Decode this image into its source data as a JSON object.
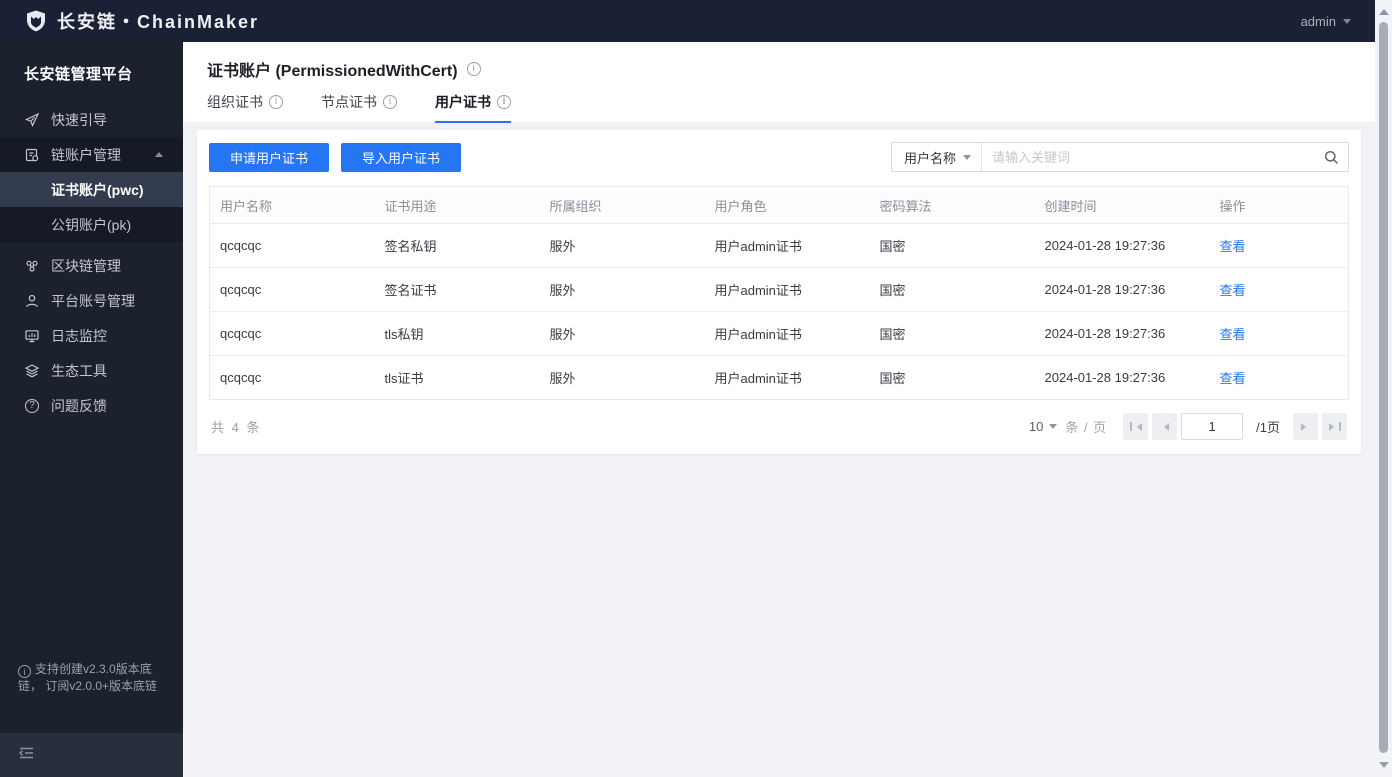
{
  "colors": {
    "accent_blue": "#2476f2",
    "topbar_bg": "#1a2134",
    "sidebar_bg": "#1c212e",
    "sidebar_selected_bg": "#333b4e",
    "page_bg": "#f1f2f6"
  },
  "topbar": {
    "brand": "长安链・ChainMaker",
    "user": "admin"
  },
  "sidebar": {
    "platform_title": "长安链管理平台",
    "items": [
      {
        "label": "快速引导",
        "icon": "rocket-icon"
      },
      {
        "label": "链账户管理",
        "icon": "chain-account-icon",
        "expanded": true,
        "children": [
          {
            "label": "证书账户(pwc)",
            "active": true
          },
          {
            "label": "公钥账户(pk)",
            "active": false
          }
        ]
      },
      {
        "label": "区块链管理",
        "icon": "blockchain-icon"
      },
      {
        "label": "平台账号管理",
        "icon": "user-icon"
      },
      {
        "label": "日志监控",
        "icon": "monitor-icon"
      },
      {
        "label": "生态工具",
        "icon": "layers-icon"
      },
      {
        "label": "问题反馈",
        "icon": "question-icon"
      }
    ],
    "version_note": "支持创建v2.3.0版本底链， 订阅v2.0.0+版本底链"
  },
  "page": {
    "title": "证书账户 (PermissionedWithCert)",
    "tabs": [
      {
        "label": "组织证书"
      },
      {
        "label": "节点证书"
      },
      {
        "label": "用户证书",
        "active": true
      }
    ]
  },
  "toolbar": {
    "apply_button": "申请用户证书",
    "import_button": "导入用户证书",
    "search_selector": "用户名称",
    "search_placeholder": "请输入关键词"
  },
  "table": {
    "columns": [
      "用户名称",
      "证书用途",
      "所属组织",
      "用户角色",
      "密码算法",
      "创建时间",
      "操作"
    ],
    "rows": [
      {
        "name": "qcqcqc",
        "usage": "签名私钥",
        "org": "服外",
        "role": "用户admin证书",
        "algorithm": "国密",
        "created": "2024-01-28 19:27:36",
        "action": "查看"
      },
      {
        "name": "qcqcqc",
        "usage": "签名证书",
        "org": "服外",
        "role": "用户admin证书",
        "algorithm": "国密",
        "created": "2024-01-28 19:27:36",
        "action": "查看"
      },
      {
        "name": "qcqcqc",
        "usage": "tls私钥",
        "org": "服外",
        "role": "用户admin证书",
        "algorithm": "国密",
        "created": "2024-01-28 19:27:36",
        "action": "查看"
      },
      {
        "name": "qcqcqc",
        "usage": "tls证书",
        "org": "服外",
        "role": "用户admin证书",
        "algorithm": "国密",
        "created": "2024-01-28 19:27:36",
        "action": "查看"
      }
    ]
  },
  "pagination": {
    "total_text": "共 4 条",
    "page_size": "10",
    "unit_text": "条 / 页",
    "current_page": "1",
    "pages_text": "/1页"
  }
}
